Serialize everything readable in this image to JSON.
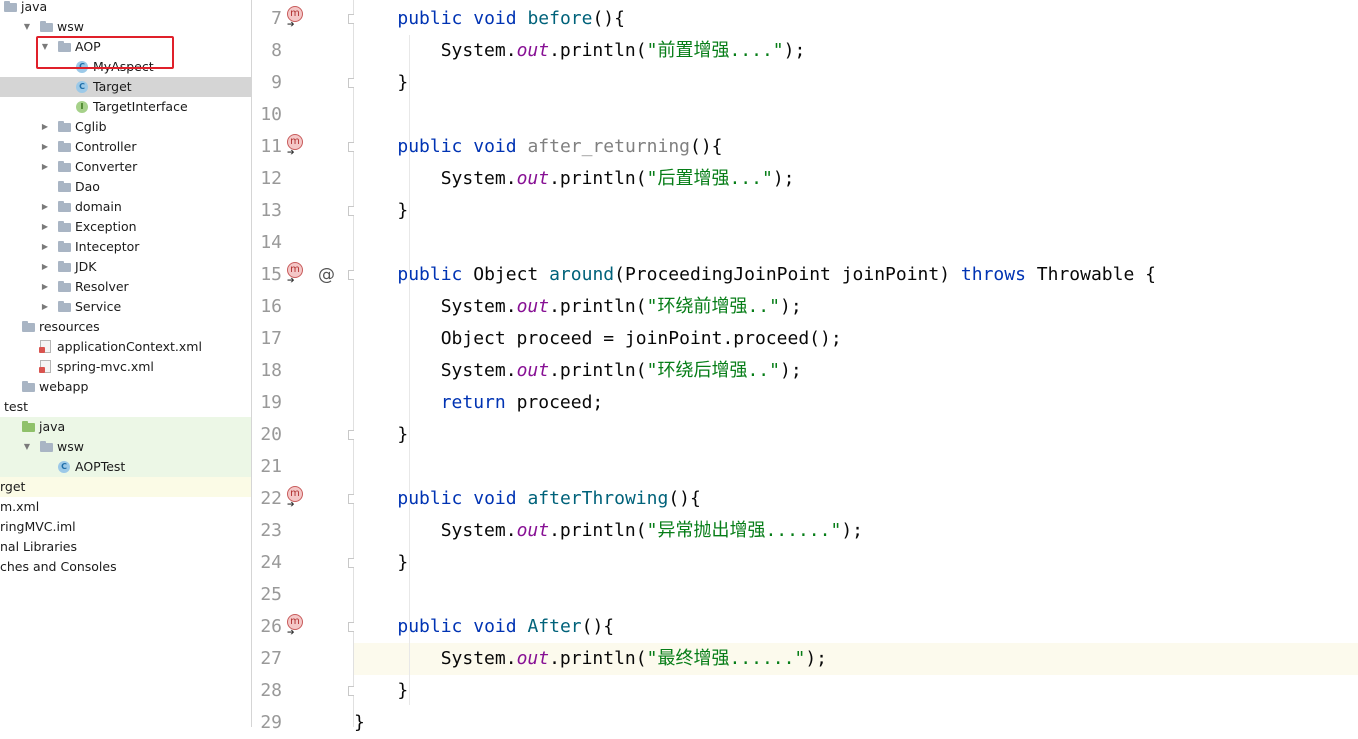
{
  "project_tree": {
    "rows": [
      {
        "label": "java",
        "indent": 4,
        "icon": "folder",
        "arrow": "",
        "state": ""
      },
      {
        "label": "wsw",
        "indent": 40,
        "icon": "folder",
        "arrow": "down",
        "state": ""
      },
      {
        "label": "AOP",
        "indent": 58,
        "icon": "folder",
        "arrow": "down",
        "state": ""
      },
      {
        "label": "MyAspect",
        "indent": 76,
        "icon": "class",
        "arrow": "",
        "state": ""
      },
      {
        "label": "Target",
        "indent": 76,
        "icon": "class",
        "arrow": "",
        "state": "selected"
      },
      {
        "label": "TargetInterface",
        "indent": 76,
        "icon": "interface",
        "arrow": "",
        "state": ""
      },
      {
        "label": "Cglib",
        "indent": 58,
        "icon": "folder",
        "arrow": "right",
        "state": ""
      },
      {
        "label": "Controller",
        "indent": 58,
        "icon": "folder",
        "arrow": "right",
        "state": ""
      },
      {
        "label": "Converter",
        "indent": 58,
        "icon": "folder",
        "arrow": "right",
        "state": ""
      },
      {
        "label": "Dao",
        "indent": 58,
        "icon": "folder",
        "arrow": "",
        "state": ""
      },
      {
        "label": "domain",
        "indent": 58,
        "icon": "folder",
        "arrow": "right",
        "state": ""
      },
      {
        "label": "Exception",
        "indent": 58,
        "icon": "folder",
        "arrow": "right",
        "state": ""
      },
      {
        "label": "Inteceptor",
        "indent": 58,
        "icon": "folder",
        "arrow": "right",
        "state": ""
      },
      {
        "label": "JDK",
        "indent": 58,
        "icon": "folder",
        "arrow": "right",
        "state": ""
      },
      {
        "label": "Resolver",
        "indent": 58,
        "icon": "folder",
        "arrow": "right",
        "state": ""
      },
      {
        "label": "Service",
        "indent": 58,
        "icon": "folder",
        "arrow": "right",
        "state": ""
      },
      {
        "label": "resources",
        "indent": 22,
        "icon": "folder",
        "arrow": "",
        "state": ""
      },
      {
        "label": "applicationContext.xml",
        "indent": 40,
        "icon": "xml",
        "arrow": "",
        "state": ""
      },
      {
        "label": "spring-mvc.xml",
        "indent": 40,
        "icon": "xml",
        "arrow": "",
        "state": ""
      },
      {
        "label": "webapp",
        "indent": 22,
        "icon": "folder",
        "arrow": "",
        "state": ""
      },
      {
        "label": "test",
        "indent": 4,
        "icon": "",
        "arrow": "",
        "state": ""
      },
      {
        "label": "java",
        "indent": 22,
        "icon": "folder-green",
        "arrow": "",
        "state": "green"
      },
      {
        "label": "wsw",
        "indent": 40,
        "icon": "folder",
        "arrow": "down",
        "state": "green"
      },
      {
        "label": "AOPTest",
        "indent": 58,
        "icon": "class",
        "arrow": "",
        "state": "green"
      },
      {
        "label": "rget",
        "indent": 0,
        "icon": "",
        "arrow": "",
        "state": "yellow"
      },
      {
        "label": "m.xml",
        "indent": 0,
        "icon": "",
        "arrow": "",
        "state": ""
      },
      {
        "label": "ringMVC.iml",
        "indent": 0,
        "icon": "",
        "arrow": "",
        "state": ""
      },
      {
        "label": "nal Libraries",
        "indent": 0,
        "icon": "",
        "arrow": "",
        "state": ""
      },
      {
        "label": "ches and Consoles",
        "indent": 0,
        "icon": "",
        "arrow": "",
        "state": ""
      }
    ]
  },
  "gutter": {
    "lines": [
      {
        "n": "7",
        "mark": true,
        "at": false,
        "fold": true
      },
      {
        "n": "8",
        "mark": false,
        "at": false,
        "fold": false
      },
      {
        "n": "9",
        "mark": false,
        "at": false,
        "fold": true
      },
      {
        "n": "10",
        "mark": false,
        "at": false,
        "fold": false
      },
      {
        "n": "11",
        "mark": true,
        "at": false,
        "fold": true
      },
      {
        "n": "12",
        "mark": false,
        "at": false,
        "fold": false
      },
      {
        "n": "13",
        "mark": false,
        "at": false,
        "fold": true
      },
      {
        "n": "14",
        "mark": false,
        "at": false,
        "fold": false
      },
      {
        "n": "15",
        "mark": true,
        "at": true,
        "fold": true
      },
      {
        "n": "16",
        "mark": false,
        "at": false,
        "fold": false
      },
      {
        "n": "17",
        "mark": false,
        "at": false,
        "fold": false
      },
      {
        "n": "18",
        "mark": false,
        "at": false,
        "fold": false
      },
      {
        "n": "19",
        "mark": false,
        "at": false,
        "fold": false
      },
      {
        "n": "20",
        "mark": false,
        "at": false,
        "fold": true
      },
      {
        "n": "21",
        "mark": false,
        "at": false,
        "fold": false
      },
      {
        "n": "22",
        "mark": true,
        "at": false,
        "fold": true
      },
      {
        "n": "23",
        "mark": false,
        "at": false,
        "fold": false
      },
      {
        "n": "24",
        "mark": false,
        "at": false,
        "fold": true
      },
      {
        "n": "25",
        "mark": false,
        "at": false,
        "fold": false
      },
      {
        "n": "26",
        "mark": true,
        "at": false,
        "fold": true
      },
      {
        "n": "27",
        "mark": false,
        "at": false,
        "fold": false
      },
      {
        "n": "28",
        "mark": false,
        "at": false,
        "fold": true
      },
      {
        "n": "29",
        "mark": false,
        "at": false,
        "fold": false
      }
    ],
    "mark_glyph": "m",
    "at_glyph": "@"
  },
  "code": {
    "current_line": 27,
    "lines": [
      [
        {
          "t": "    "
        },
        {
          "t": "public",
          "c": "kw"
        },
        {
          "t": " "
        },
        {
          "t": "void",
          "c": "kw"
        },
        {
          "t": " "
        },
        {
          "t": "before",
          "c": "fn"
        },
        {
          "t": "(){"
        }
      ],
      [
        {
          "t": "        System."
        },
        {
          "t": "out",
          "c": "field"
        },
        {
          "t": ".println("
        },
        {
          "t": "\"前置增强....\"",
          "c": "str"
        },
        {
          "t": ");"
        }
      ],
      [
        {
          "t": "    }"
        }
      ],
      [
        {
          "t": ""
        }
      ],
      [
        {
          "t": "    "
        },
        {
          "t": "public",
          "c": "kw"
        },
        {
          "t": " "
        },
        {
          "t": "void",
          "c": "kw"
        },
        {
          "t": " "
        },
        {
          "t": "after_returning",
          "c": "fn-unused"
        },
        {
          "t": "(){"
        }
      ],
      [
        {
          "t": "        System."
        },
        {
          "t": "out",
          "c": "field"
        },
        {
          "t": ".println("
        },
        {
          "t": "\"后置增强...\"",
          "c": "str"
        },
        {
          "t": ");"
        }
      ],
      [
        {
          "t": "    }"
        }
      ],
      [
        {
          "t": ""
        }
      ],
      [
        {
          "t": "    "
        },
        {
          "t": "public",
          "c": "kw"
        },
        {
          "t": " Object "
        },
        {
          "t": "around",
          "c": "fn"
        },
        {
          "t": "(ProceedingJoinPoint joinPoint) "
        },
        {
          "t": "throws",
          "c": "kw"
        },
        {
          "t": " Throwable {"
        }
      ],
      [
        {
          "t": "        System."
        },
        {
          "t": "out",
          "c": "field"
        },
        {
          "t": ".println("
        },
        {
          "t": "\"环绕前增强..\"",
          "c": "str"
        },
        {
          "t": ");"
        }
      ],
      [
        {
          "t": "        Object proceed = joinPoint.proceed();"
        }
      ],
      [
        {
          "t": "        System."
        },
        {
          "t": "out",
          "c": "field"
        },
        {
          "t": ".println("
        },
        {
          "t": "\"环绕后增强..\"",
          "c": "str"
        },
        {
          "t": ");"
        }
      ],
      [
        {
          "t": "        "
        },
        {
          "t": "return",
          "c": "kw"
        },
        {
          "t": " proceed;"
        }
      ],
      [
        {
          "t": "    }"
        }
      ],
      [
        {
          "t": ""
        }
      ],
      [
        {
          "t": "    "
        },
        {
          "t": "public",
          "c": "kw"
        },
        {
          "t": " "
        },
        {
          "t": "void",
          "c": "kw"
        },
        {
          "t": " "
        },
        {
          "t": "afterThrowing",
          "c": "fn"
        },
        {
          "t": "(){"
        }
      ],
      [
        {
          "t": "        System."
        },
        {
          "t": "out",
          "c": "field"
        },
        {
          "t": ".println("
        },
        {
          "t": "\"异常抛出增强......\"",
          "c": "str"
        },
        {
          "t": ");"
        }
      ],
      [
        {
          "t": "    }"
        }
      ],
      [
        {
          "t": ""
        }
      ],
      [
        {
          "t": "    "
        },
        {
          "t": "public",
          "c": "kw"
        },
        {
          "t": " "
        },
        {
          "t": "void",
          "c": "kw"
        },
        {
          "t": " "
        },
        {
          "t": "After",
          "c": "fn"
        },
        {
          "t": "(){"
        }
      ],
      [
        {
          "t": "        System."
        },
        {
          "t": "out",
          "c": "field"
        },
        {
          "t": ".println("
        },
        {
          "t": "\"最终增强......\"",
          "c": "str"
        },
        {
          "t": ");"
        }
      ],
      [
        {
          "t": "    }"
        }
      ],
      [
        {
          "t": "}"
        }
      ]
    ]
  },
  "colors": {
    "highlight_box": "#e0202a",
    "keyword": "#0033b3",
    "method": "#00627a",
    "string": "#067d17",
    "field": "#871094"
  }
}
